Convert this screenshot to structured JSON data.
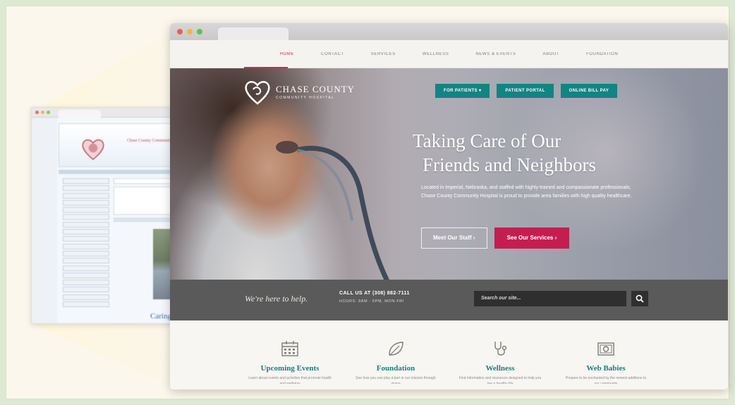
{
  "old_site": {
    "site_name": "Chase County Community",
    "caption": "Caring"
  },
  "nav": {
    "items": [
      "HOME",
      "CONTACT",
      "SERVICES",
      "WELLNESS",
      "NEWS & EVENTS",
      "ABOUT",
      "FOUNDATION"
    ],
    "active": "HOME"
  },
  "brand": {
    "name": "CHASE COUNTY",
    "subtitle": "COMMUNITY HOSPITAL"
  },
  "hero": {
    "buttons": [
      "FOR PATIENTS ▾",
      "PATIENT PORTAL",
      "ONLINE BILL PAY"
    ],
    "title_line1": "Taking Care of Our",
    "title_line2": "Friends and Neighbors",
    "text": "Located in Imperial, Nebraska, and staffed with highly-trained and compassionate professionals, Chase County Community Hospital is proud to provide area families with high quality healthcare.",
    "cta_secondary": "Meet Our Staff ›",
    "cta_primary": "See Our Services ›"
  },
  "helpbar": {
    "tagline": "We're here to help.",
    "call": "CALL US AT (308) 882-7111",
    "hours": "HOURS: 8AM - 5PM, MON-FRI",
    "search_placeholder": "Search our site..."
  },
  "features": [
    {
      "icon": "calendar-icon",
      "title": "Upcoming Events",
      "desc": "Learn about events and activities that promote health and wellness"
    },
    {
      "icon": "leaf-icon",
      "title": "Foundation",
      "desc": "See how you can play a part in our mission through giving"
    },
    {
      "icon": "stethoscope-icon",
      "title": "Wellness",
      "desc": "Find information and resources designed to help you live a healthy life"
    },
    {
      "icon": "camera-icon",
      "title": "Web Babies",
      "desc": "Prepare to be enchanted by the newest additions to our community"
    }
  ],
  "colors": {
    "brand_red": "#c41e50",
    "teal": "#128483",
    "helpbar": "#5b5a5a",
    "feature_title": "#1b7d7d"
  }
}
